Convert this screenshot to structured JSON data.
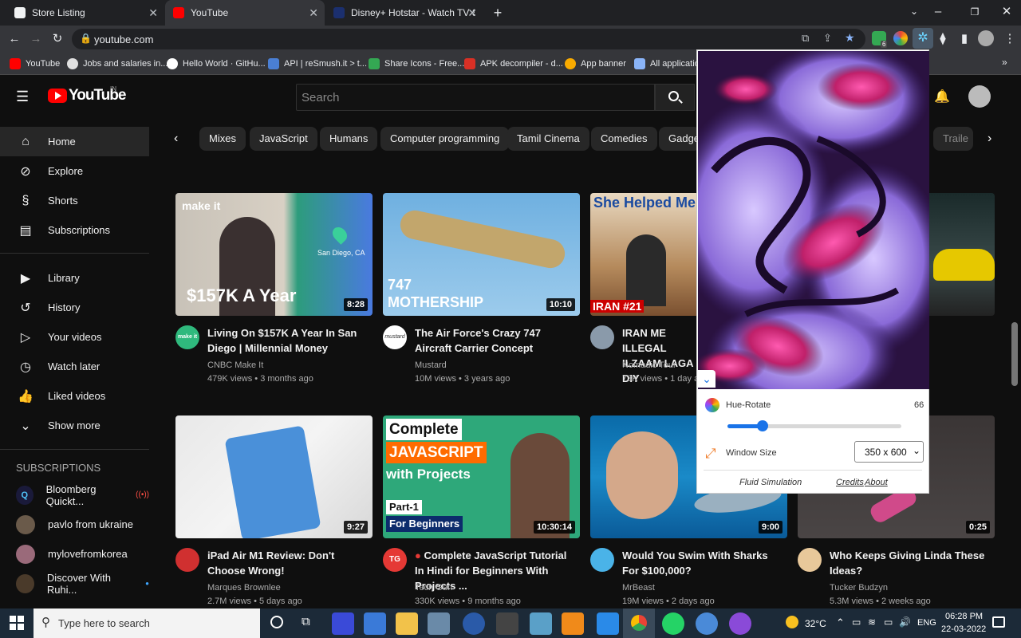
{
  "browser": {
    "tabs": [
      {
        "title": "Store Listing",
        "active": false
      },
      {
        "title": "YouTube",
        "active": true
      },
      {
        "title": "Disney+ Hotstar - Watch TV Sho",
        "active": false
      }
    ],
    "url": "youtube.com",
    "bookmarks": [
      "YouTube",
      "Jobs and salaries in...",
      "Hello World · GitHu...",
      "API | reSmush.it > t...",
      "Share Icons - Free...",
      "APK decompiler - d...",
      "App banner",
      "All application"
    ],
    "extension_badge": "6"
  },
  "youtube": {
    "logo_text": "YouTube",
    "logo_region": "IN",
    "search_placeholder": "Search",
    "sidebar": {
      "main": [
        "Home",
        "Explore",
        "Shorts",
        "Subscriptions"
      ],
      "library": [
        "Library",
        "History",
        "Your videos",
        "Watch later",
        "Liked videos",
        "Show more"
      ],
      "subscriptions_header": "SUBSCRIPTIONS",
      "subscriptions": [
        "Bloomberg Quickt...",
        "pavlo from ukraine",
        "mylovefromkorea",
        "Discover With Ruhi..."
      ]
    },
    "chips": [
      "Mixes",
      "JavaScript",
      "Humans",
      "Computer programming",
      "Tamil Cinema",
      "Comedies",
      "Gadge",
      "Traile"
    ],
    "videos": [
      {
        "title": "Living On $157K A Year In San Diego | Millennial Money",
        "channel": "CNBC Make It",
        "meta": "479K views • 3 months ago",
        "duration": "8:28",
        "thumb_text": "$157K A Year",
        "thumb_logo": "make it",
        "map_label": "San Diego, CA",
        "avatar_text": "make it"
      },
      {
        "title": "The Air Force's Crazy 747 Aircraft Carrier Concept",
        "channel": "Mustard",
        "meta": "10M views • 3 years ago",
        "duration": "10:10",
        "thumb_text": "747 MOTHERSHIP",
        "avatar_text": "mustard"
      },
      {
        "title": "IRAN ME ILLEGAL ILZAAM LAGA DIY",
        "channel": "Nomadic Tour",
        "meta": "73K views • 1 day ag",
        "duration": "",
        "thumb_text": "She Helped Me In",
        "thumb_badge": "IRAN #21"
      },
      {
        "title": "",
        "channel": "",
        "meta": "",
        "duration": "",
        "thumb_text": ""
      },
      {
        "title": "iPad Air M1 Review: Don't Choose Wrong!",
        "channel": "Marques Brownlee",
        "meta": "2.7M views • 5 days ago",
        "duration": "9:27",
        "thumb_text": ""
      },
      {
        "title": "Complete JavaScript Tutorial In Hindi for Beginners With Projects ...",
        "channel": "Tech Gun",
        "meta": "330K views • 9 months ago",
        "duration": "10:30:14",
        "thumb_text": "Complete JAVASCRIPT with Projects",
        "thumb_sub": "Part-1 For Beginners",
        "avatar_text": "TG"
      },
      {
        "title": "Would You Swim With Sharks For $100,000?",
        "channel": "MrBeast",
        "meta": "19M views • 2 days ago",
        "duration": "9:00",
        "thumb_text": ""
      },
      {
        "title": "Who Keeps Giving Linda These Ideas?",
        "channel": "Tucker Budzyn",
        "meta": "5.3M views • 2 weeks ago",
        "duration": "0:25",
        "thumb_text": ""
      }
    ]
  },
  "extension": {
    "hue_label": "Hue-Rotate",
    "hue_value": "66",
    "hue_fraction": 0.2,
    "window_size_label": "Window Size",
    "window_size_value": "350 x 600",
    "footer_title": "Fluid Simulation",
    "credits": "Credits",
    "about": "About"
  },
  "taskbar": {
    "search_placeholder": "Type here to search",
    "temperature": "32°C",
    "language": "ENG",
    "time": "06:28 PM",
    "date": "22-03-2022"
  }
}
